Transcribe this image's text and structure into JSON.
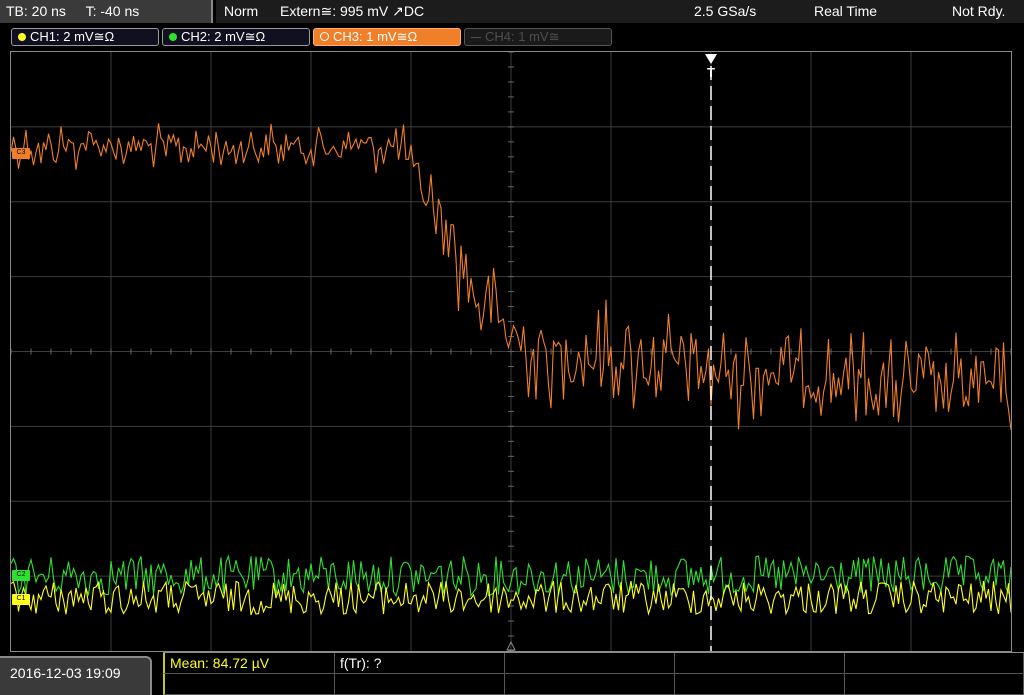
{
  "header": {
    "timebase": "TB: 20 ns",
    "trigger_offset": "T: -40 ns",
    "mode": "Norm",
    "trigger_source": "Extern≅: 995 mV ↗DC",
    "sample_rate": "2.5 GSa/s",
    "acq_mode": "Real Time",
    "status": "Not Rdy."
  },
  "channels": [
    {
      "label": "CH1: 2 mV≅Ω",
      "color": "#ffff20",
      "state": "on"
    },
    {
      "label": "CH2: 2 mV≅Ω",
      "color": "#30e030",
      "state": "on"
    },
    {
      "label": "CH3: 1 mV≅Ω",
      "color": "#f07f2a",
      "state": "selected"
    },
    {
      "label": "CH4: 1 mV≅",
      "color": "#4e4e4e",
      "state": "off"
    }
  ],
  "markers": {
    "ch3": "C3",
    "ch2": "C2",
    "ch1": "C1",
    "trigger": "T"
  },
  "footer": {
    "datetime": "2016-12-03 19:09",
    "measurement_1": "Mean: 84.72 µV",
    "measurement_2": "f(Tr): ?"
  },
  "colors": {
    "ch1": "#ffff20",
    "ch2": "#30e030",
    "ch3": "#f07f2a",
    "grid": "#3c3c3c",
    "trigger_line": "#ffffff"
  }
}
